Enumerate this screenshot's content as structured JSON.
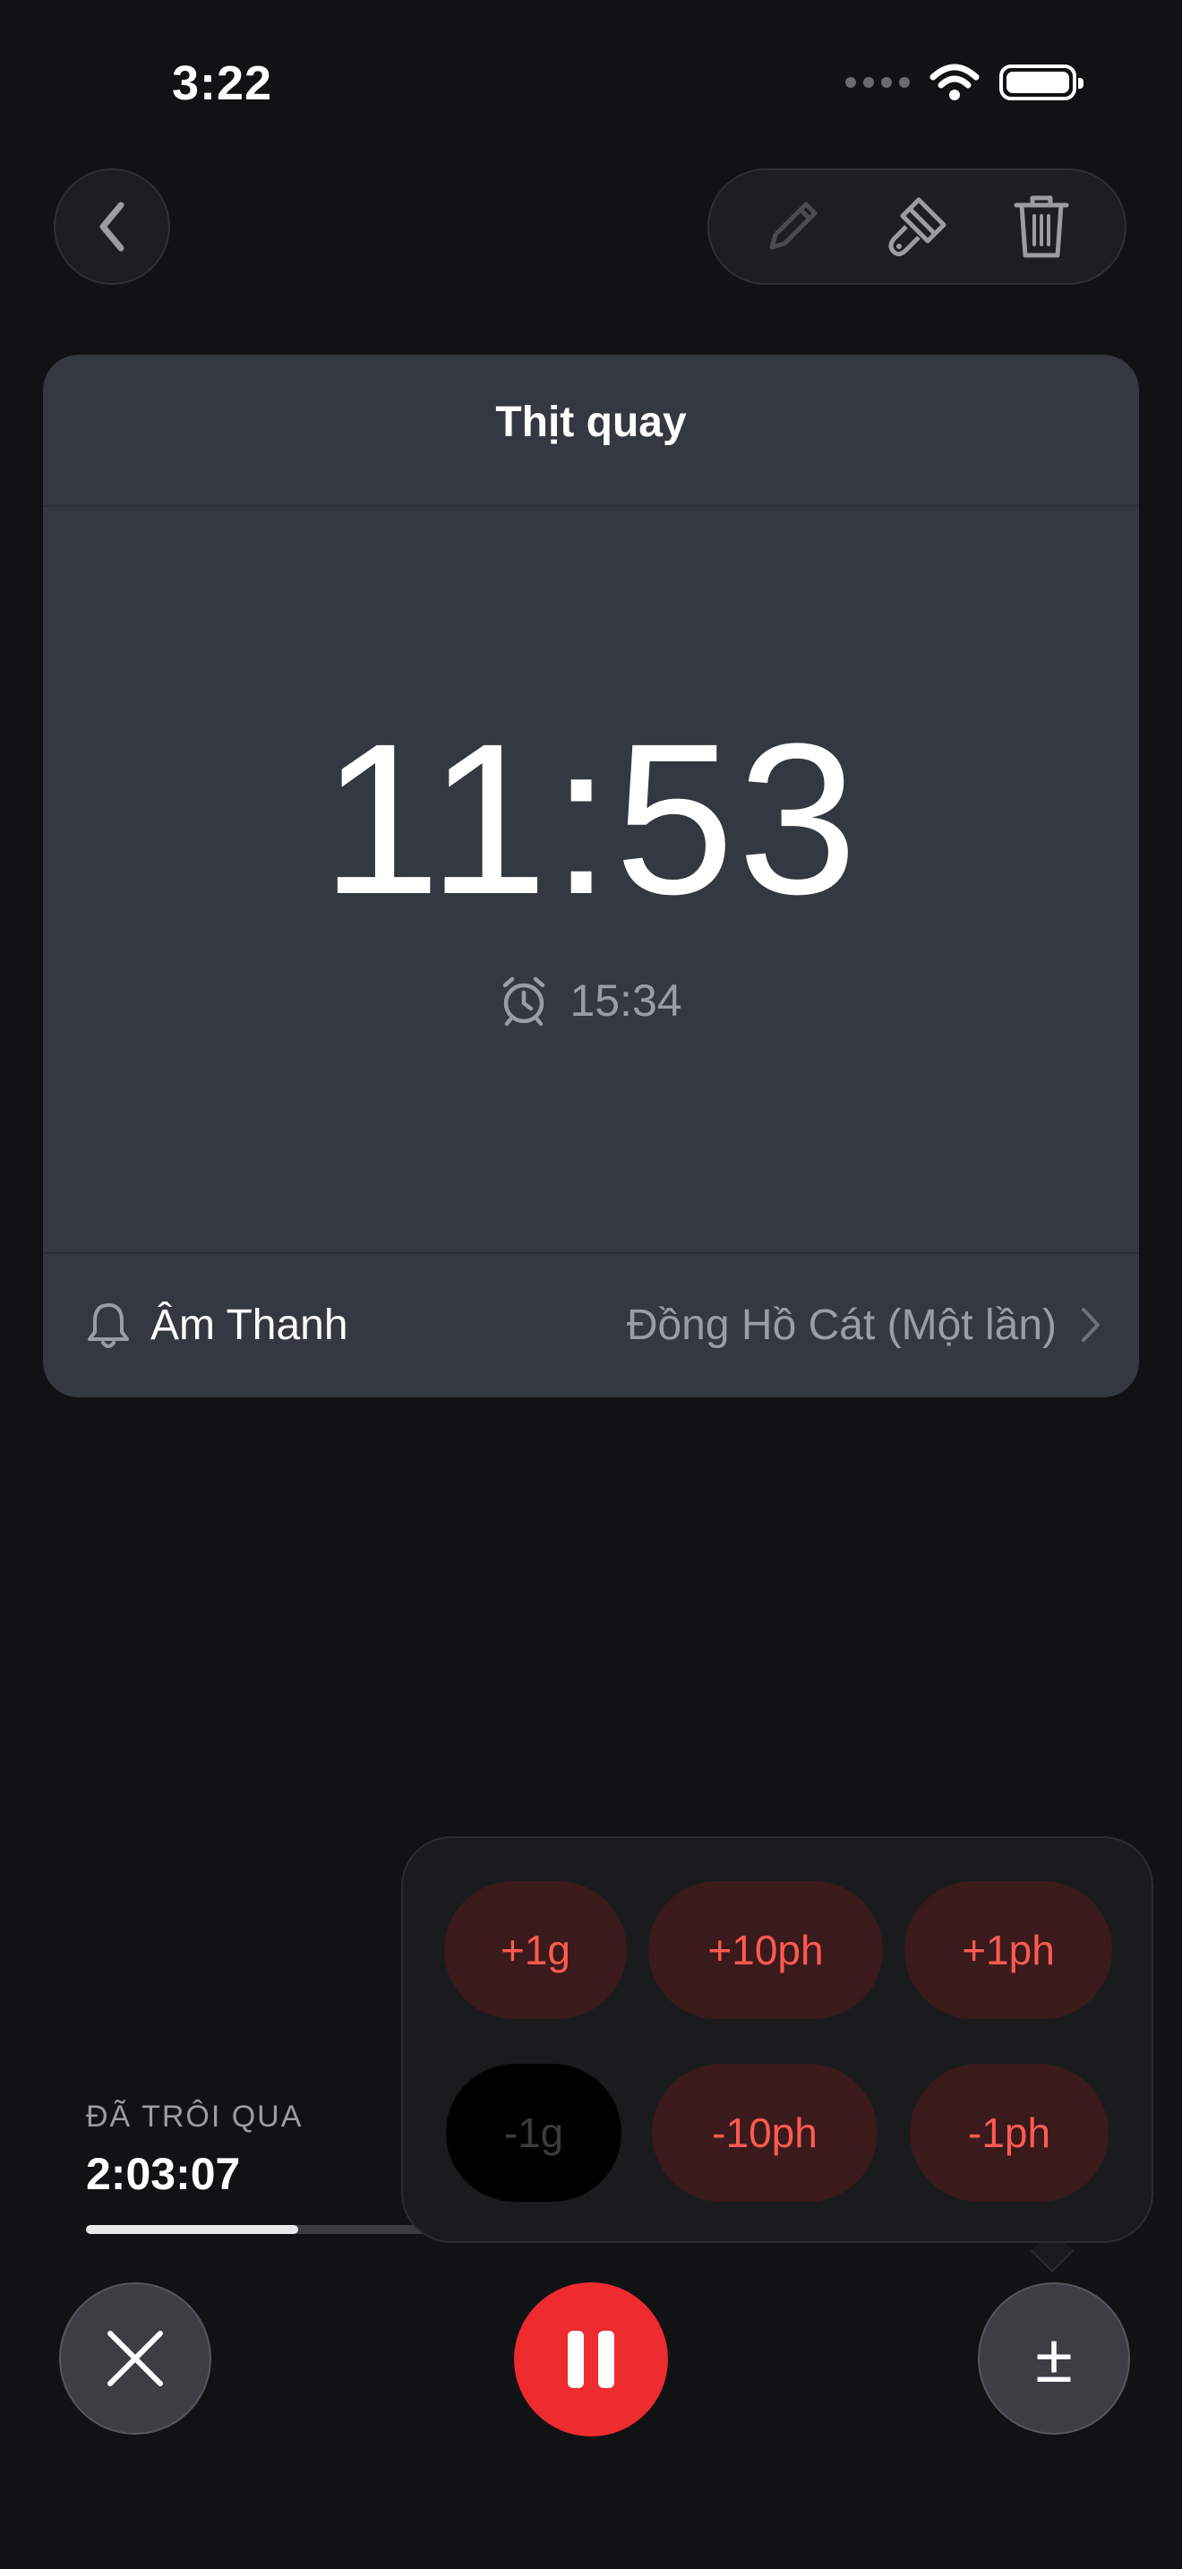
{
  "status_bar": {
    "time": "3:22"
  },
  "timer": {
    "title": "Thịt quay",
    "remaining": "11:53",
    "end_time": "15:34",
    "sound_label": "Âm Thanh",
    "sound_value": "Đồng Hồ Cát (Một lần)"
  },
  "elapsed": {
    "label": "ĐÃ TRÔI QUA",
    "value": "2:03:07",
    "progress_fraction": 0.21
  },
  "adjust_popup": {
    "plus_1h": "+1g",
    "plus_10m": "+10ph",
    "plus_1m": "+1ph",
    "minus_1h": "-1g",
    "minus_10m": "-10ph",
    "minus_1m": "-1ph"
  },
  "controls": {
    "adjust_symbol": "±"
  },
  "colors": {
    "accent_red": "#ee2b2f",
    "adjust_text": "#ff5a52",
    "card_bg": "#343840",
    "background": "#111214"
  },
  "icons": {
    "back": "chevron-left-icon",
    "edit": "pencil-icon",
    "theme": "paintbrush-icon",
    "delete": "trash-icon",
    "alarm": "alarm-clock-icon",
    "sound": "bell-icon",
    "cancel": "x-icon",
    "pause": "pause-icon"
  }
}
